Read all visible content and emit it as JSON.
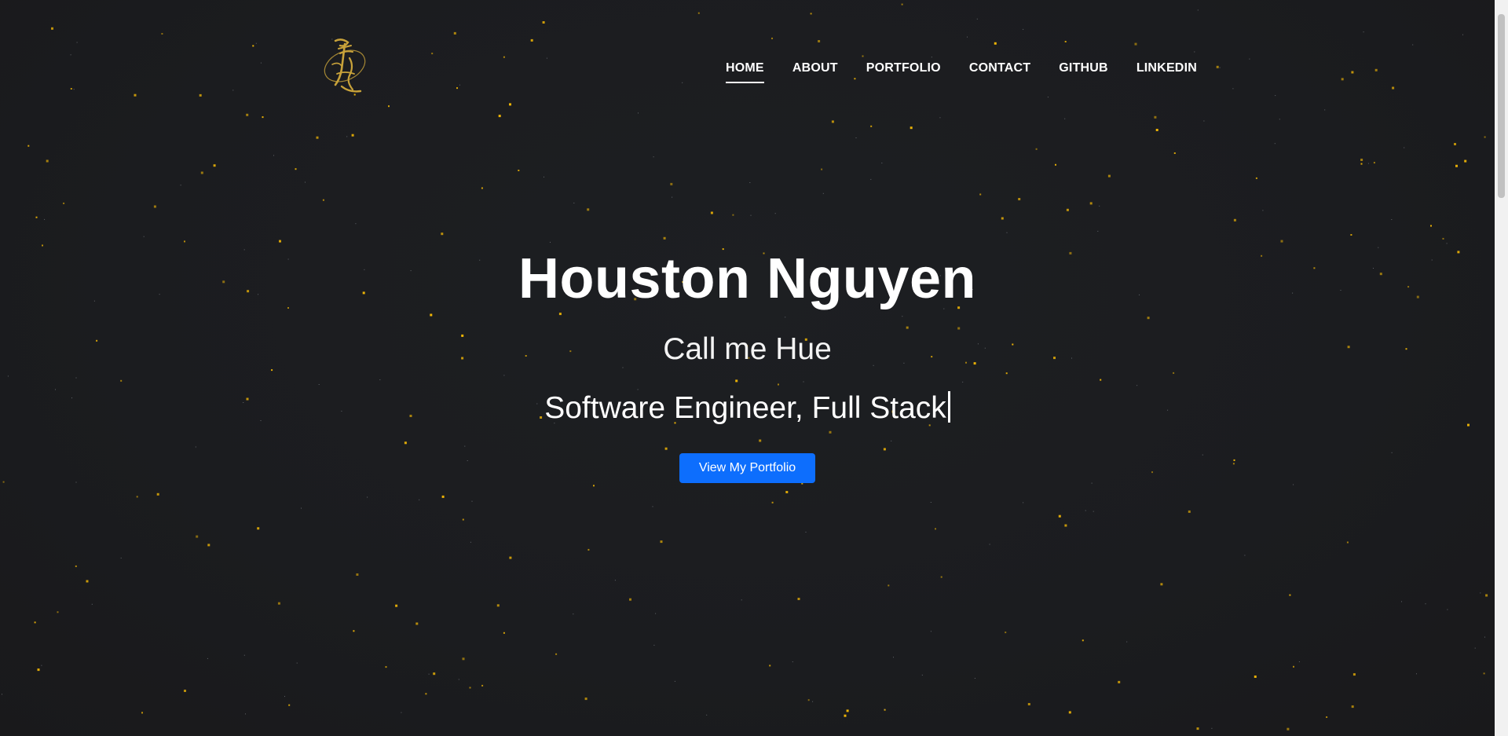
{
  "brand": {
    "logo_icon": "calligraphy-logo-icon",
    "logo_color": "#c8a23a"
  },
  "nav": {
    "items": [
      {
        "label": "HOME",
        "active": true
      },
      {
        "label": "ABOUT",
        "active": false
      },
      {
        "label": "PORTFOLIO",
        "active": false
      },
      {
        "label": "CONTACT",
        "active": false
      },
      {
        "label": "GITHUB",
        "active": false
      },
      {
        "label": "LINKEDIN",
        "active": false
      }
    ]
  },
  "hero": {
    "name": "Houston Nguyen",
    "nickname": "Call me Hue",
    "role": "Software Engineer, Full Stack",
    "cta_label": "View My Portfolio"
  },
  "theme": {
    "background": "#1b1c1f",
    "star_color": "#f2b705",
    "accent": "#0d6efd"
  }
}
